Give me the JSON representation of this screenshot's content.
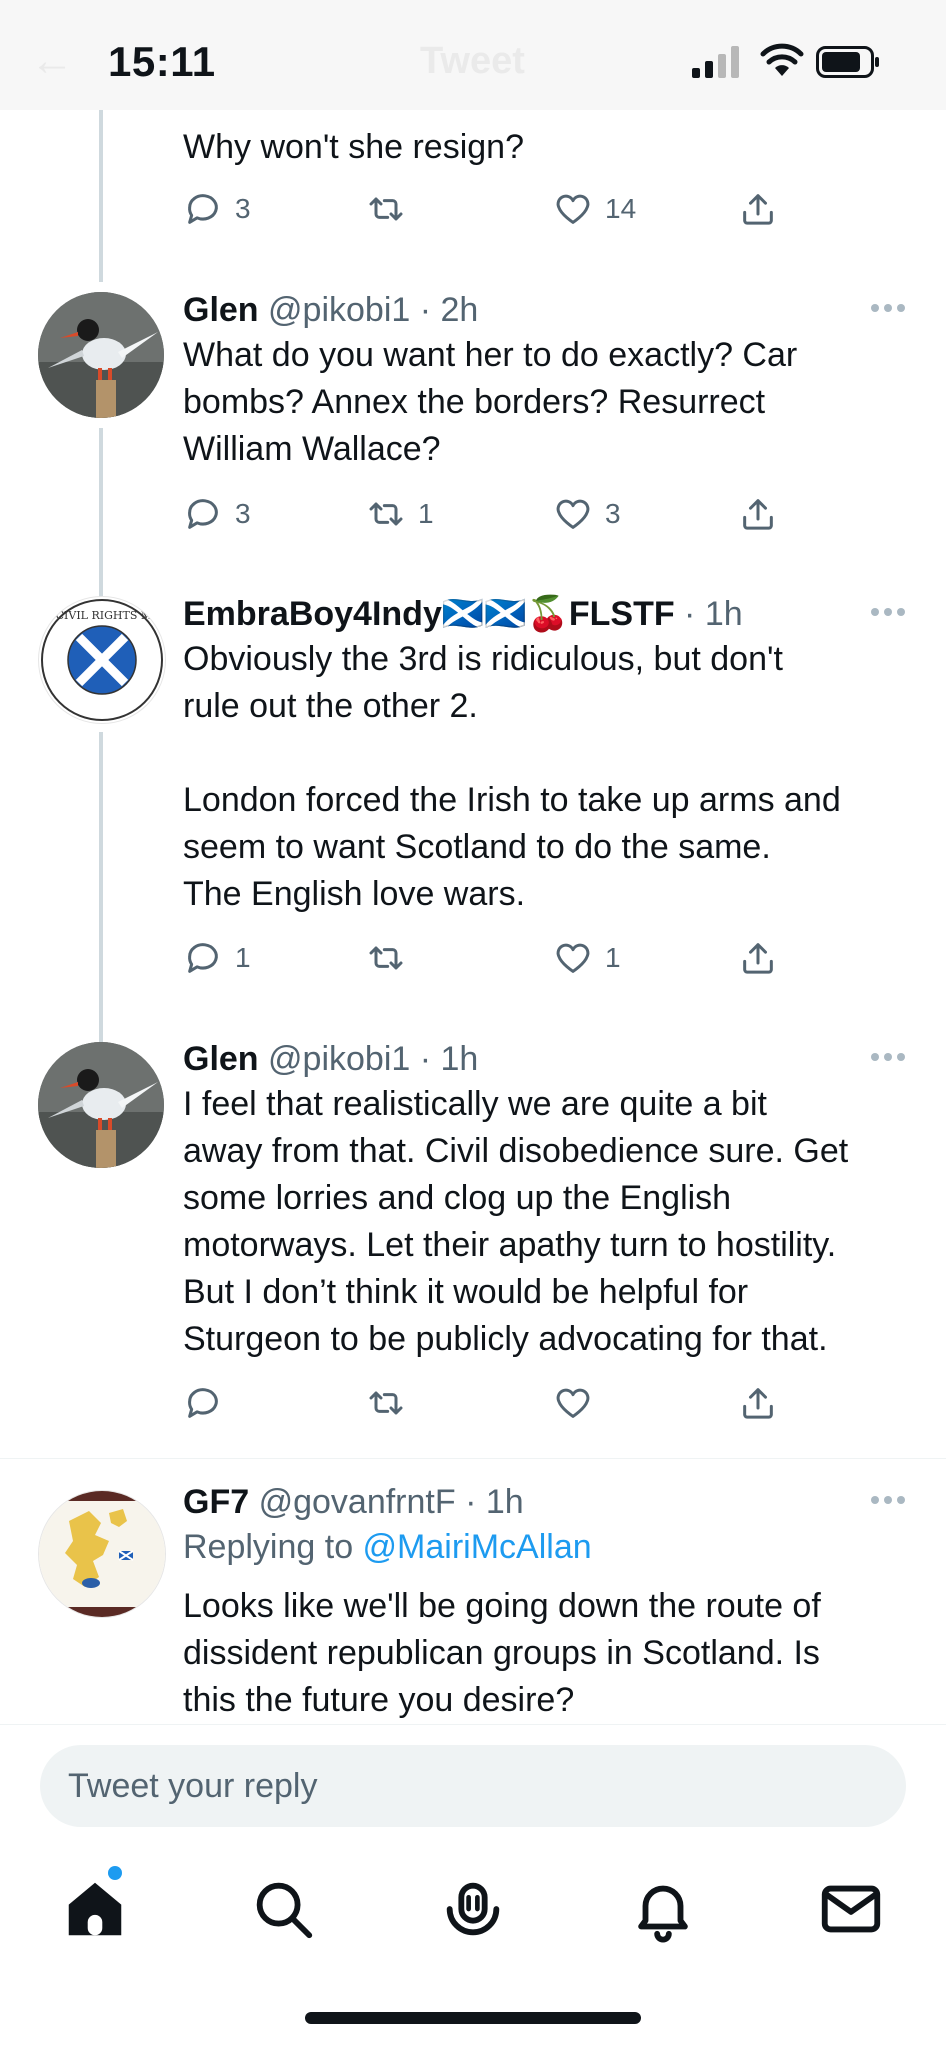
{
  "status_bar": {
    "time": "15:11",
    "ghost_title": "Tweet"
  },
  "tweets": [
    {
      "id": "t0",
      "text_lines": [
        "Why won't she resign?"
      ],
      "replies": "3",
      "retweets": "",
      "likes": "14"
    },
    {
      "id": "t1",
      "name": "Glen",
      "handle": "@pikobi1",
      "time": "2h",
      "text_lines": [
        "What do you want her to do exactly? Car",
        "bombs? Annex the borders? Resurrect",
        "William Wallace?"
      ],
      "replies": "3",
      "retweets": "1",
      "likes": "3"
    },
    {
      "id": "t2",
      "name": "EmbraBoy4Indy🏴󠁧󠁢󠁳󠁣󠁴󠁿🏴󠁧󠁢󠁳󠁣󠁴󠁿🍒FLSTF",
      "handle": "",
      "time": "1h",
      "avatar_text": "SCOTTISH CIVIL RIGHTS MOVEMENT",
      "text_lines": [
        "Obviously the 3rd is ridiculous, but don't",
        "rule out the other 2.",
        "",
        "London forced the Irish to take up arms and",
        "seem to want Scotland to do the same.",
        "The English love wars."
      ],
      "replies": "1",
      "retweets": "",
      "likes": "1"
    },
    {
      "id": "t3",
      "name": "Glen",
      "handle": "@pikobi1",
      "time": "1h",
      "text_lines": [
        "I feel that realistically we are quite a bit",
        "away from that. Civil disobedience sure. Get",
        "some lorries and clog up the English",
        "motorways. Let their apathy turn to hostility.",
        "But I don’t think it would be helpful for",
        "Sturgeon to be publicly advocating for that."
      ],
      "replies": "",
      "retweets": "",
      "likes": ""
    },
    {
      "id": "t4",
      "name": "GF7",
      "handle": "@govanfrntF",
      "time": "1h",
      "replying_prefix": "Replying to ",
      "replying_to": "@MairiMcAllan",
      "text_lines": [
        "Looks like we'll be going down the route of",
        "dissident republican groups in Scotland. Is",
        "this the future you desire?"
      ]
    }
  ],
  "composer": {
    "placeholder": "Tweet your reply"
  },
  "tabs": [
    {
      "name": "home-icon"
    },
    {
      "name": "search-icon"
    },
    {
      "name": "spaces-icon"
    },
    {
      "name": "notifications-icon"
    },
    {
      "name": "messages-icon"
    }
  ],
  "colors": {
    "accent": "#1d9bf0",
    "muted": "#536471",
    "thread_line": "#cfd9de"
  }
}
